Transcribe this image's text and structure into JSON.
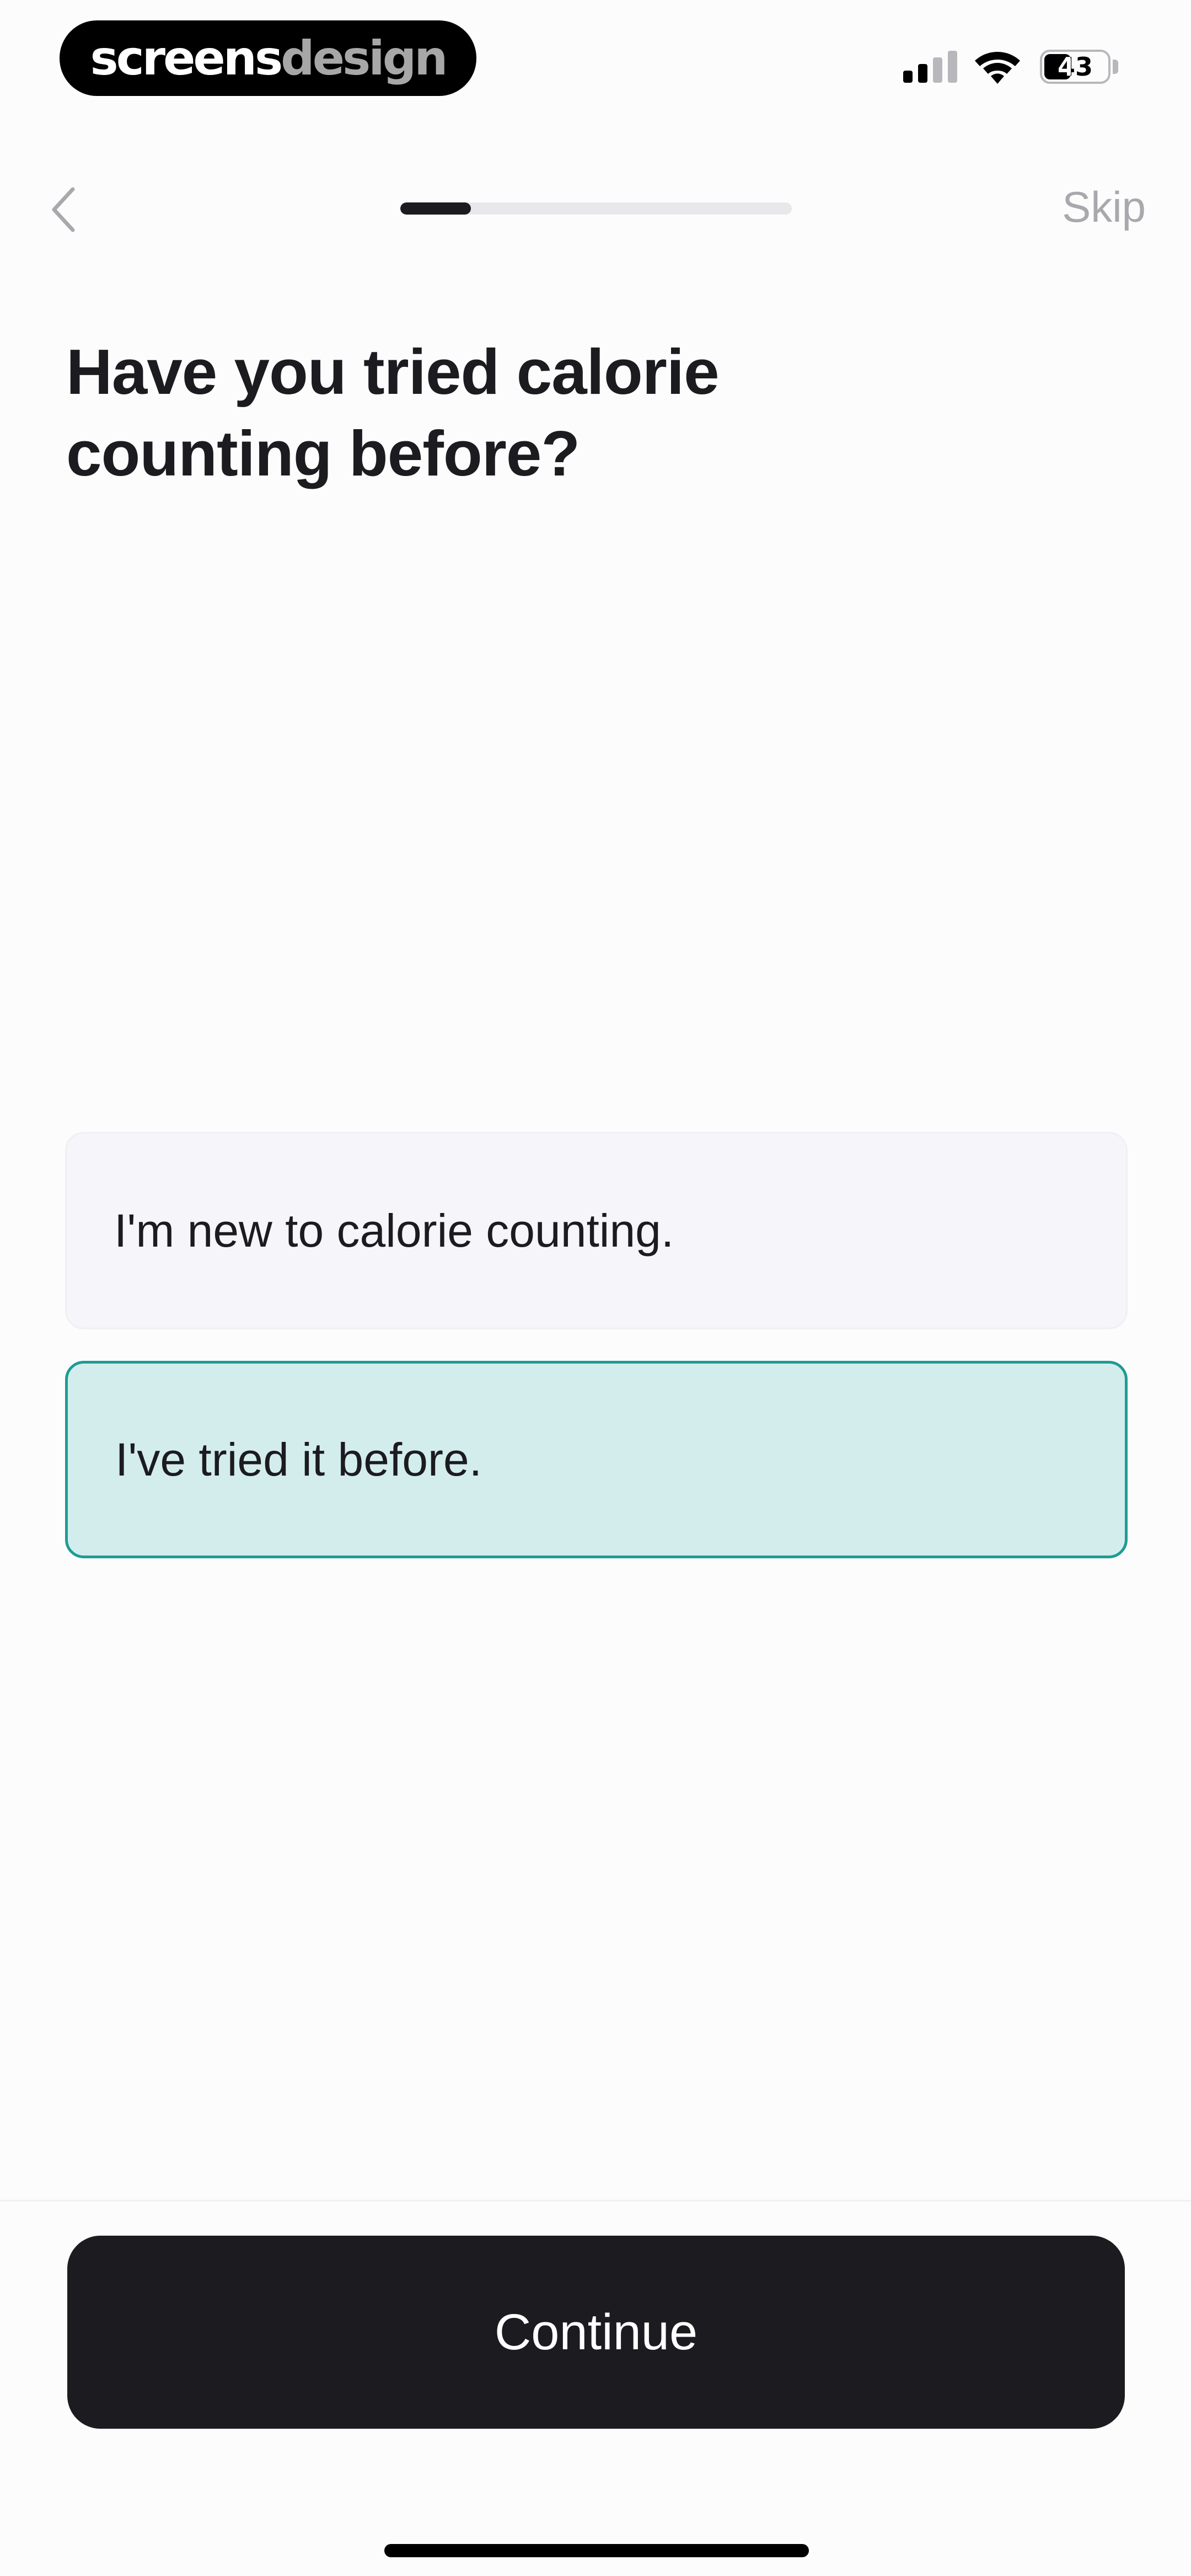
{
  "status_bar": {
    "brand_part1": "screens",
    "brand_part2": "design",
    "battery_level": "43",
    "signal_bars_active": 2,
    "signal_bars_total": 4,
    "icons": [
      "signal-icon",
      "wifi-icon",
      "battery-icon"
    ]
  },
  "nav": {
    "back_icon": "chevron-left-icon",
    "progress_fraction": 0.18,
    "skip_label": "Skip"
  },
  "question": {
    "title_line1": "Have you tried calorie",
    "title_line2": "counting before?"
  },
  "options": [
    {
      "label": "I'm new to calorie counting.",
      "selected": false
    },
    {
      "label": "I've tried it before.",
      "selected": true
    }
  ],
  "footer": {
    "continue_label": "Continue"
  },
  "colors": {
    "accent": "#1d9c94",
    "selected_background": "#d3eded",
    "unselected_background": "#f6f5fa",
    "button_background": "#1c1b1f"
  }
}
